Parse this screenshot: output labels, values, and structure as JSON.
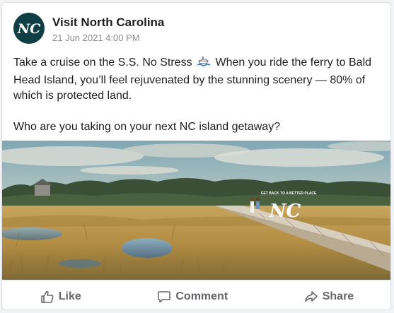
{
  "post": {
    "page_name": "Visit North Carolina",
    "avatar_text": "NC",
    "timestamp": "21 Jun 2021 4:00 PM",
    "paragraph_1_part_1": "Take a cruise on the S.S. No Stress",
    "paragraph_1_part_2": "When you ride the ferry to Bald Head Island, you’ll feel rejuvenated by the stunning scenery — 80% of which is protected land.",
    "paragraph_2": "Who are you taking on your next NC island getaway?"
  },
  "media": {
    "overlay_tagline": "GET BACK TO A BETTER PLACE",
    "overlay_logo": "NC"
  },
  "actions": {
    "like_label": "Like",
    "comment_label": "Comment",
    "share_label": "Share"
  },
  "icons": {
    "inline_emoji": "ship-icon",
    "like": "thumbs-up-icon",
    "comment": "comment-bubble-icon",
    "share": "share-arrow-icon"
  },
  "colors": {
    "avatar_bg": "#0f3f44",
    "text_primary": "#1c1e21",
    "text_secondary": "#65676b",
    "timestamp": "#8a8d91"
  }
}
